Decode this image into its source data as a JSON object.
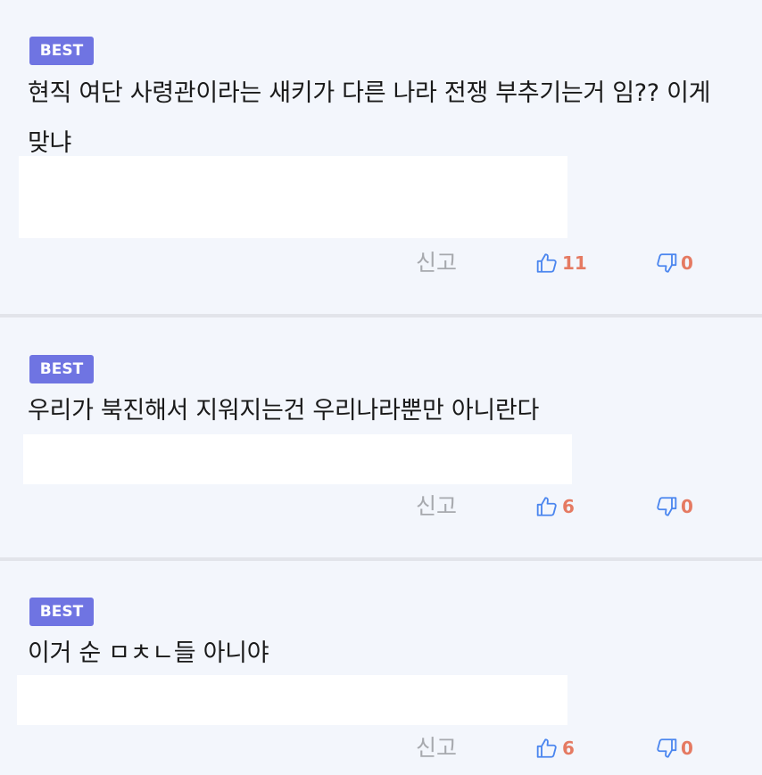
{
  "colors": {
    "badge_bg": "#6f74e2",
    "thumb_icon": "#4b86ef",
    "count_text": "#e57a62",
    "report_text": "#a7a9ae",
    "background": "#f3f6fc"
  },
  "comments": [
    {
      "badge": "BEST",
      "text": "현직 여단 사령관이라는 새키가 다른 나라 전쟁 부추기는거 임?? 이게 맞냐",
      "report_label": "신고",
      "likes": "11",
      "dislikes": "0",
      "like_icon": "thumbs-up-icon",
      "dislike_icon": "thumbs-down-icon"
    },
    {
      "badge": "BEST",
      "text": "우리가 북진해서 지워지는건 우리나라뿐만 아니란다",
      "report_label": "신고",
      "likes": "6",
      "dislikes": "0",
      "like_icon": "thumbs-up-icon",
      "dislike_icon": "thumbs-down-icon"
    },
    {
      "badge": "BEST",
      "text": "이거 순 ㅁㅊㄴ들 아니야",
      "report_label": "신고",
      "likes": "6",
      "dislikes": "0",
      "like_icon": "thumbs-up-icon",
      "dislike_icon": "thumbs-down-icon"
    }
  ]
}
